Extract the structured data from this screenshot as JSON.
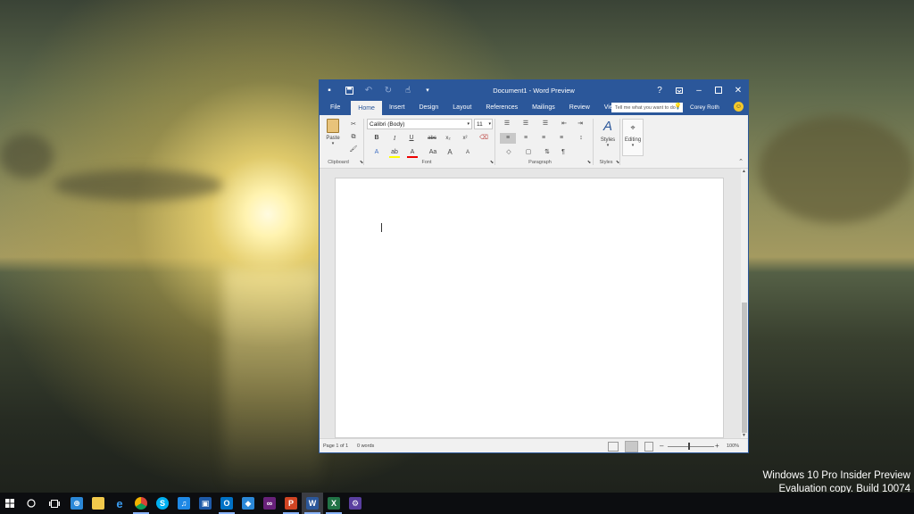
{
  "window": {
    "title": "Document1 - Word Preview",
    "tabs": [
      "File",
      "Home",
      "Insert",
      "Design",
      "Layout",
      "References",
      "Mailings",
      "Review",
      "View"
    ],
    "active_tab": "Home",
    "tell_me_placeholder": "Tell me what you want to do",
    "user": "Corey Roth",
    "ribbon": {
      "clipboard": {
        "label": "Clipboard",
        "paste": "Paste"
      },
      "font": {
        "label": "Font",
        "font_name": "Calibri (Body)",
        "font_size": "11",
        "bold": "B",
        "italic": "I",
        "underline": "U",
        "strikethrough": "abc",
        "subscript": "x₂",
        "superscript": "x²",
        "change_case": "Aa",
        "grow": "A",
        "shrink": "A"
      },
      "paragraph": {
        "label": "Paragraph"
      },
      "styles": {
        "label": "Styles",
        "button": "Styles"
      },
      "editing": {
        "button": "Editing"
      }
    },
    "status": {
      "page": "Page 1 of 1",
      "words": "0 words",
      "zoom": "100%"
    }
  },
  "desktop": {
    "watermark_line1": "Windows 10 Pro Insider Preview",
    "watermark_line2": "Evaluation copy. Build 10074"
  },
  "taskbar_apps": [
    {
      "name": "start-icon"
    },
    {
      "name": "search-icon"
    },
    {
      "name": "task-view-icon"
    },
    {
      "name": "store-icon",
      "color": "#2b88d8"
    },
    {
      "name": "file-explorer-icon",
      "color": "#f2c94c"
    },
    {
      "name": "edge-icon",
      "color": "#1e88e5"
    },
    {
      "name": "chrome-icon",
      "color": "#dd4b39"
    },
    {
      "name": "skype-icon",
      "color": "#00aff0"
    },
    {
      "name": "headphones-icon",
      "color": "#1e88e5"
    },
    {
      "name": "remote-desktop-icon",
      "color": "#1e5aa8"
    },
    {
      "name": "outlook-icon",
      "color": "#0072c6"
    },
    {
      "name": "app-icon",
      "color": "#2b88d8"
    },
    {
      "name": "visual-studio-icon",
      "color": "#68217a"
    },
    {
      "name": "powerpoint-icon",
      "color": "#d04423"
    },
    {
      "name": "word-icon",
      "color": "#2b579a"
    },
    {
      "name": "excel-icon",
      "color": "#217346"
    },
    {
      "name": "settings-icon",
      "color": "#5a3fa0"
    }
  ]
}
